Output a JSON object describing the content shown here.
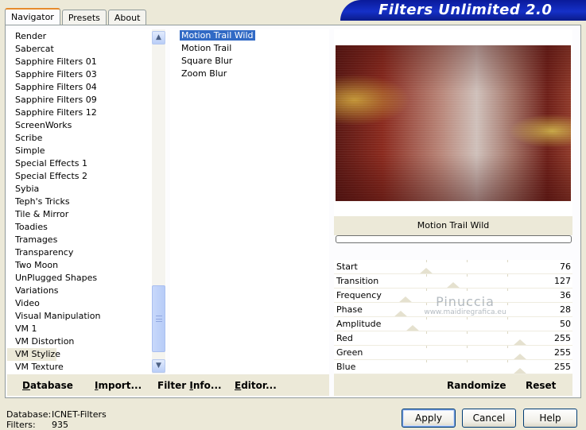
{
  "tabs": [
    "Navigator",
    "Presets",
    "About"
  ],
  "active_tab": 0,
  "banner_title": "Filters Unlimited 2.0",
  "categories": [
    "Render",
    "Sabercat",
    "Sapphire Filters 01",
    "Sapphire Filters 03",
    "Sapphire Filters 04",
    "Sapphire Filters 09",
    "Sapphire Filters 12",
    "ScreenWorks",
    "Scribe",
    "Simple",
    "Special Effects 1",
    "Special Effects 2",
    "Sybia",
    "Teph's Tricks",
    "Tile & Mirror",
    "Toadies",
    "Tramages",
    "Transparency",
    "Two Moon",
    "UnPlugged Shapes",
    "Variations",
    "Video",
    "Visual Manipulation",
    "VM 1",
    "VM Distortion",
    "VM Stylize",
    "VM Texture"
  ],
  "selected_category": "VM Stylize",
  "filters": [
    "Motion Trail Wild",
    "Motion Trail",
    "Square Blur",
    "Zoom Blur"
  ],
  "selected_filter": "Motion Trail Wild",
  "preview_title": "Motion Trail Wild",
  "params": [
    {
      "label": "Start",
      "value": "76"
    },
    {
      "label": "Transition",
      "value": "127"
    },
    {
      "label": "Frequency",
      "value": "36"
    },
    {
      "label": "Phase",
      "value": "28"
    },
    {
      "label": "Amplitude",
      "value": "50"
    },
    {
      "label": "Red",
      "value": "255"
    },
    {
      "label": "Green",
      "value": "255"
    },
    {
      "label": "Blue",
      "value": "255"
    }
  ],
  "watermark": {
    "main": "Pinuccia",
    "sub": "www.maidiregrafica.eu"
  },
  "toolbar": {
    "database": {
      "u": "D",
      "rest": "atabase"
    },
    "import": {
      "u": "I",
      "rest": "mport..."
    },
    "filter_info": {
      "pre": "Filter ",
      "u": "I",
      "rest": "nfo..."
    },
    "editor": {
      "u": "E",
      "rest": "ditor..."
    },
    "randomize": "Randomize",
    "reset": "Reset"
  },
  "footer": {
    "database_label": "Database:",
    "database_value": "ICNET-Filters",
    "filters_label": "Filters:",
    "filters_value": "935"
  },
  "buttons": {
    "apply": "Apply",
    "cancel": "Cancel",
    "help": "Help"
  },
  "colors": {
    "selection": "#316ac5",
    "banner": "#1530c8",
    "tab_highlight": "#e68b2c"
  }
}
